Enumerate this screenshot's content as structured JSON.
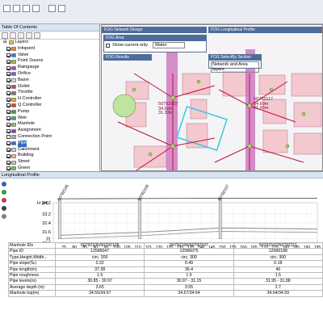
{
  "toc": {
    "title": "Table Of Contents",
    "layers_label": "Layers",
    "layers": [
      {
        "name": "Infopoint",
        "checked": true,
        "color": "#e58a30"
      },
      {
        "name": "Valve",
        "checked": true,
        "color": "#3a7bd5"
      },
      {
        "name": "Point Source",
        "checked": true,
        "color": "#8fc43f"
      },
      {
        "name": "Raingauge",
        "checked": true,
        "color": "#c040c0"
      },
      {
        "name": "Orifice",
        "checked": true,
        "color": "#6666cc"
      },
      {
        "name": "Basin",
        "checked": true,
        "color": "#d9d9d9"
      },
      {
        "name": "Outlet",
        "checked": true,
        "color": "#d04040"
      },
      {
        "name": "Throttle",
        "checked": true,
        "color": "#777777"
      },
      {
        "name": "H Controller",
        "checked": true,
        "color": "#e0b020"
      },
      {
        "name": "Q Controller",
        "checked": true,
        "color": "#e04040"
      },
      {
        "name": "Pump",
        "checked": true,
        "color": "#40a040"
      },
      {
        "name": "Weir",
        "checked": true,
        "color": "#40a0a0"
      },
      {
        "name": "Manhole",
        "checked": true,
        "color": "#90c050"
      },
      {
        "name": "Assignment",
        "checked": true,
        "color": "#8040c0"
      },
      {
        "name": "Connection Point",
        "checked": false,
        "color": "#aaaaaa"
      },
      {
        "name": "Pipe",
        "checked": true,
        "color": "#3169c6",
        "selected": true
      },
      {
        "name": "Catchment",
        "checked": true,
        "color": "#e0c0d0"
      },
      {
        "name": "Building",
        "checked": true,
        "color": "#f0b0b0"
      },
      {
        "name": "Street",
        "checked": true,
        "color": "#c0c0c0"
      },
      {
        "name": "Green",
        "checked": true,
        "color": "#60c060"
      }
    ]
  },
  "map": {
    "network_design_title": "FOG Network Design",
    "area_title": "FOG Area",
    "show_current_only_label": "Show current only",
    "area_select_value": "Water",
    "results_title": "FOG Results",
    "long_profile_title": "FOG Longitudinal Profile",
    "selection_title": "FOG SelectBy Section",
    "selection_value": "Network and Area layers",
    "label_a_line1": "50792107",
    "label_a_line2": "34.60m",
    "label_a_line3": "31.33m",
    "label_b_line1": "50792117",
    "label_b_line2": "34.60m",
    "label_b_line3": "31.65m"
  },
  "profile": {
    "title": "Longitudinal Profile",
    "manhole_labels": [
      "50792105",
      "50792106",
      "50792107"
    ]
  },
  "chart_data": {
    "type": "line",
    "ylabel": "H (m)",
    "y_ticks": [
      "34.2",
      "33.2",
      "32.4",
      "31.6",
      "31",
      "30.6"
    ],
    "x_ticks": [
      "70",
      "75",
      "80",
      "85",
      "90",
      "95",
      "100",
      "105",
      "110",
      "115",
      "120",
      "125",
      "130",
      "135",
      "140",
      "145",
      "150",
      "155",
      "160",
      "165",
      "170",
      "175",
      "180",
      "185",
      "190",
      "195"
    ],
    "xlim": [
      70,
      195
    ],
    "ylim": [
      30.6,
      34.2
    ],
    "manholes_x": [
      73,
      111,
      149
    ],
    "series": [
      {
        "x": [
          73,
          111,
          149,
          195
        ],
        "y": [
          34.55,
          34.57,
          34.6,
          34.6
        ]
      },
      {
        "x": [
          73,
          111,
          149,
          195
        ],
        "y": [
          31.3,
          31.55,
          31.95,
          31.85
        ]
      },
      {
        "x": [
          73,
          111,
          149,
          195
        ],
        "y": [
          31.0,
          31.25,
          31.65,
          31.55
        ]
      }
    ]
  },
  "table": {
    "rows": [
      {
        "label": "Manhole IDs",
        "cells": [
          "50792105/50792106",
          "50792106/50792107",
          "50792107/50792111"
        ]
      },
      {
        "label": "Pipe ID",
        "cells": [
          "12586047",
          "12586075",
          "12586188"
        ]
      },
      {
        "label": "Type,Height,Width...",
        "cells": [
          "circ. 300",
          "circ. 300",
          "circ. 300"
        ]
      },
      {
        "label": "Pipe slope(‰)",
        "cells": [
          "0.32",
          "0.49",
          "0.18"
        ]
      },
      {
        "label": "Pipe length(m)",
        "cells": [
          "37.38",
          "36.4",
          "40"
        ]
      },
      {
        "label": "Pipe roughness",
        "cells": [
          "1.5",
          "1.5",
          "1.5"
        ]
      },
      {
        "label": "Pipe levels(m)",
        "cells": [
          "30.85 - 30.97",
          "30.97 - 31.15",
          "31.95 - 31.88"
        ]
      },
      {
        "label": "Average depth (m)",
        "cells": [
          "3.65",
          "3.55",
          "2.7"
        ]
      },
      {
        "label": "Manhole top(m)",
        "cells": [
          "34.55/34.57",
          "34.57/34.64",
          "34.64/34.59"
        ]
      }
    ]
  }
}
